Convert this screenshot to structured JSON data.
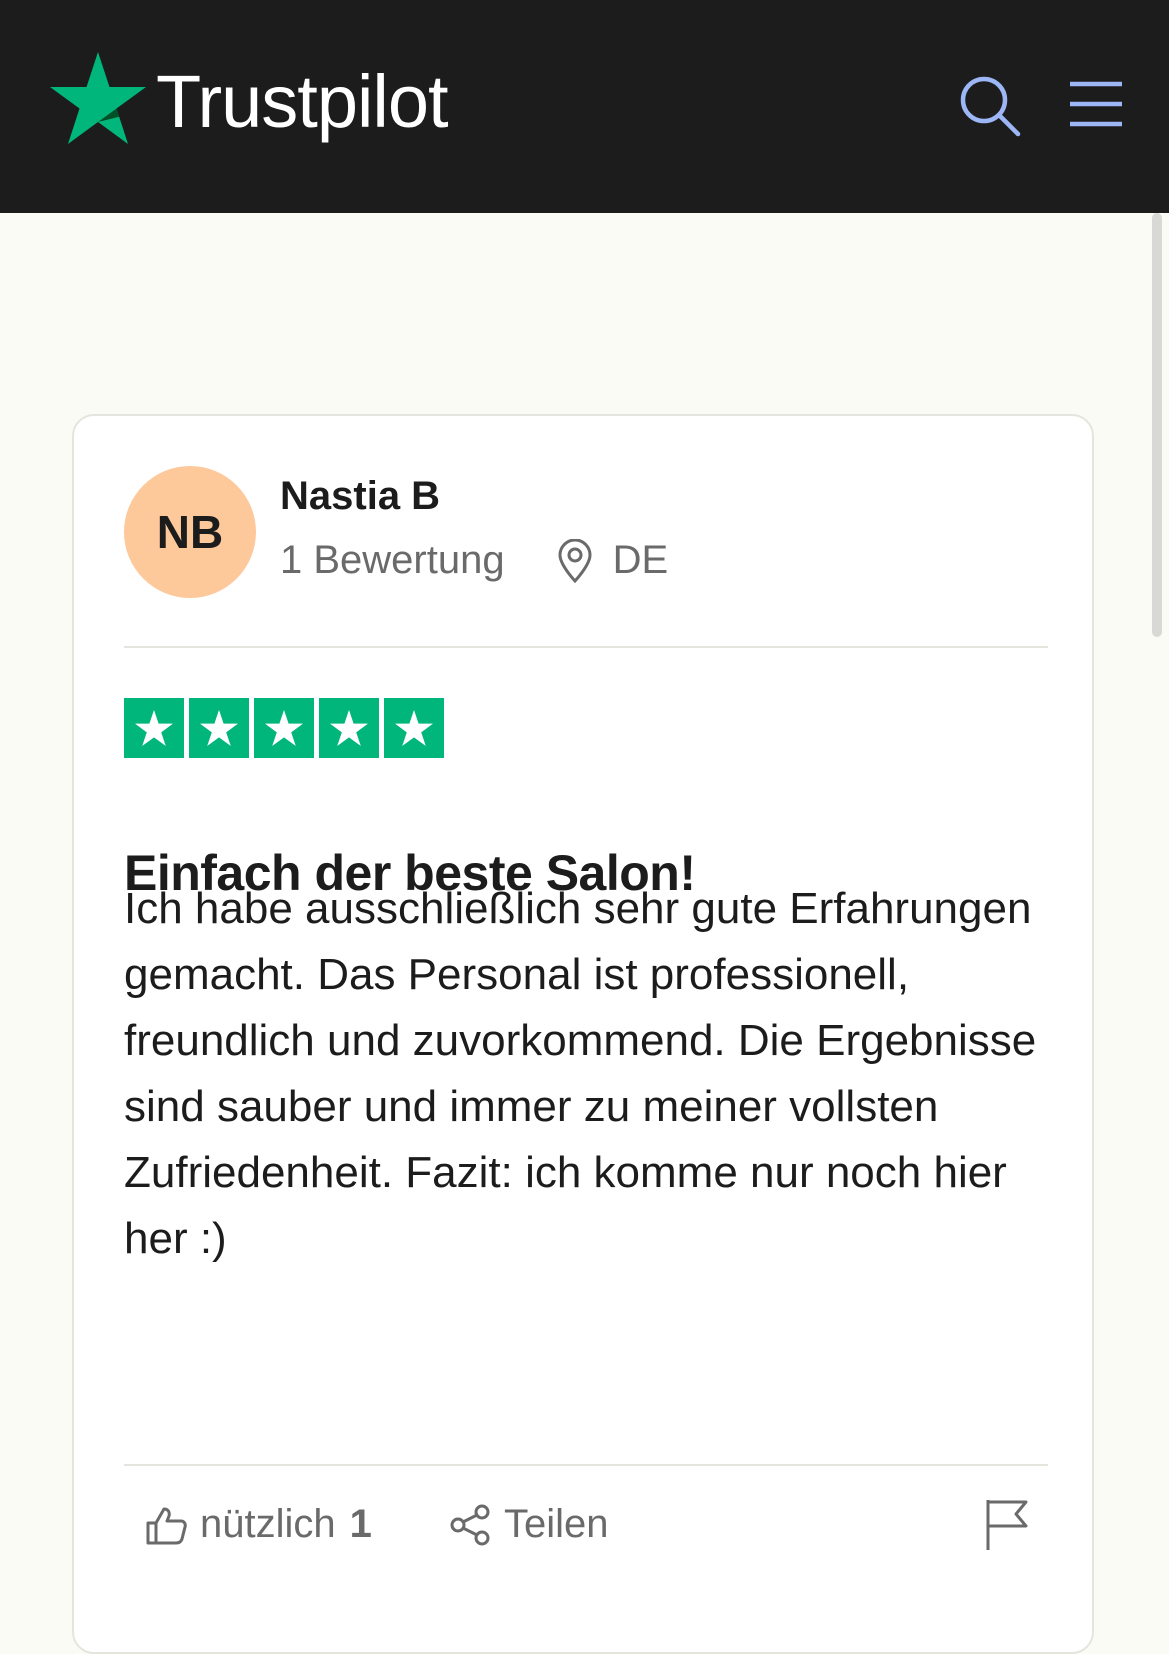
{
  "header": {
    "brand": "Trustpilot",
    "brand_color": "#00b67a",
    "icons": [
      "search-icon",
      "menu-icon"
    ]
  },
  "review": {
    "reviewer": {
      "initials": "NB",
      "name": "Nastia B",
      "review_count": "1 Bewertung",
      "country": "DE"
    },
    "rating": 5,
    "title": "Einfach der beste Salon!",
    "body": "Ich habe ausschließlich sehr gute Erfahrungen gemacht. Das Personal ist professionell, freundlich und zuvorkommend. Die Ergebnisse sind sauber und immer zu meiner vollsten Zufriedenheit. Fazit: ich komme nur noch hier her :)",
    "actions": {
      "useful_label": "nützlich",
      "useful_count": "1",
      "share_label": "Teilen"
    }
  }
}
